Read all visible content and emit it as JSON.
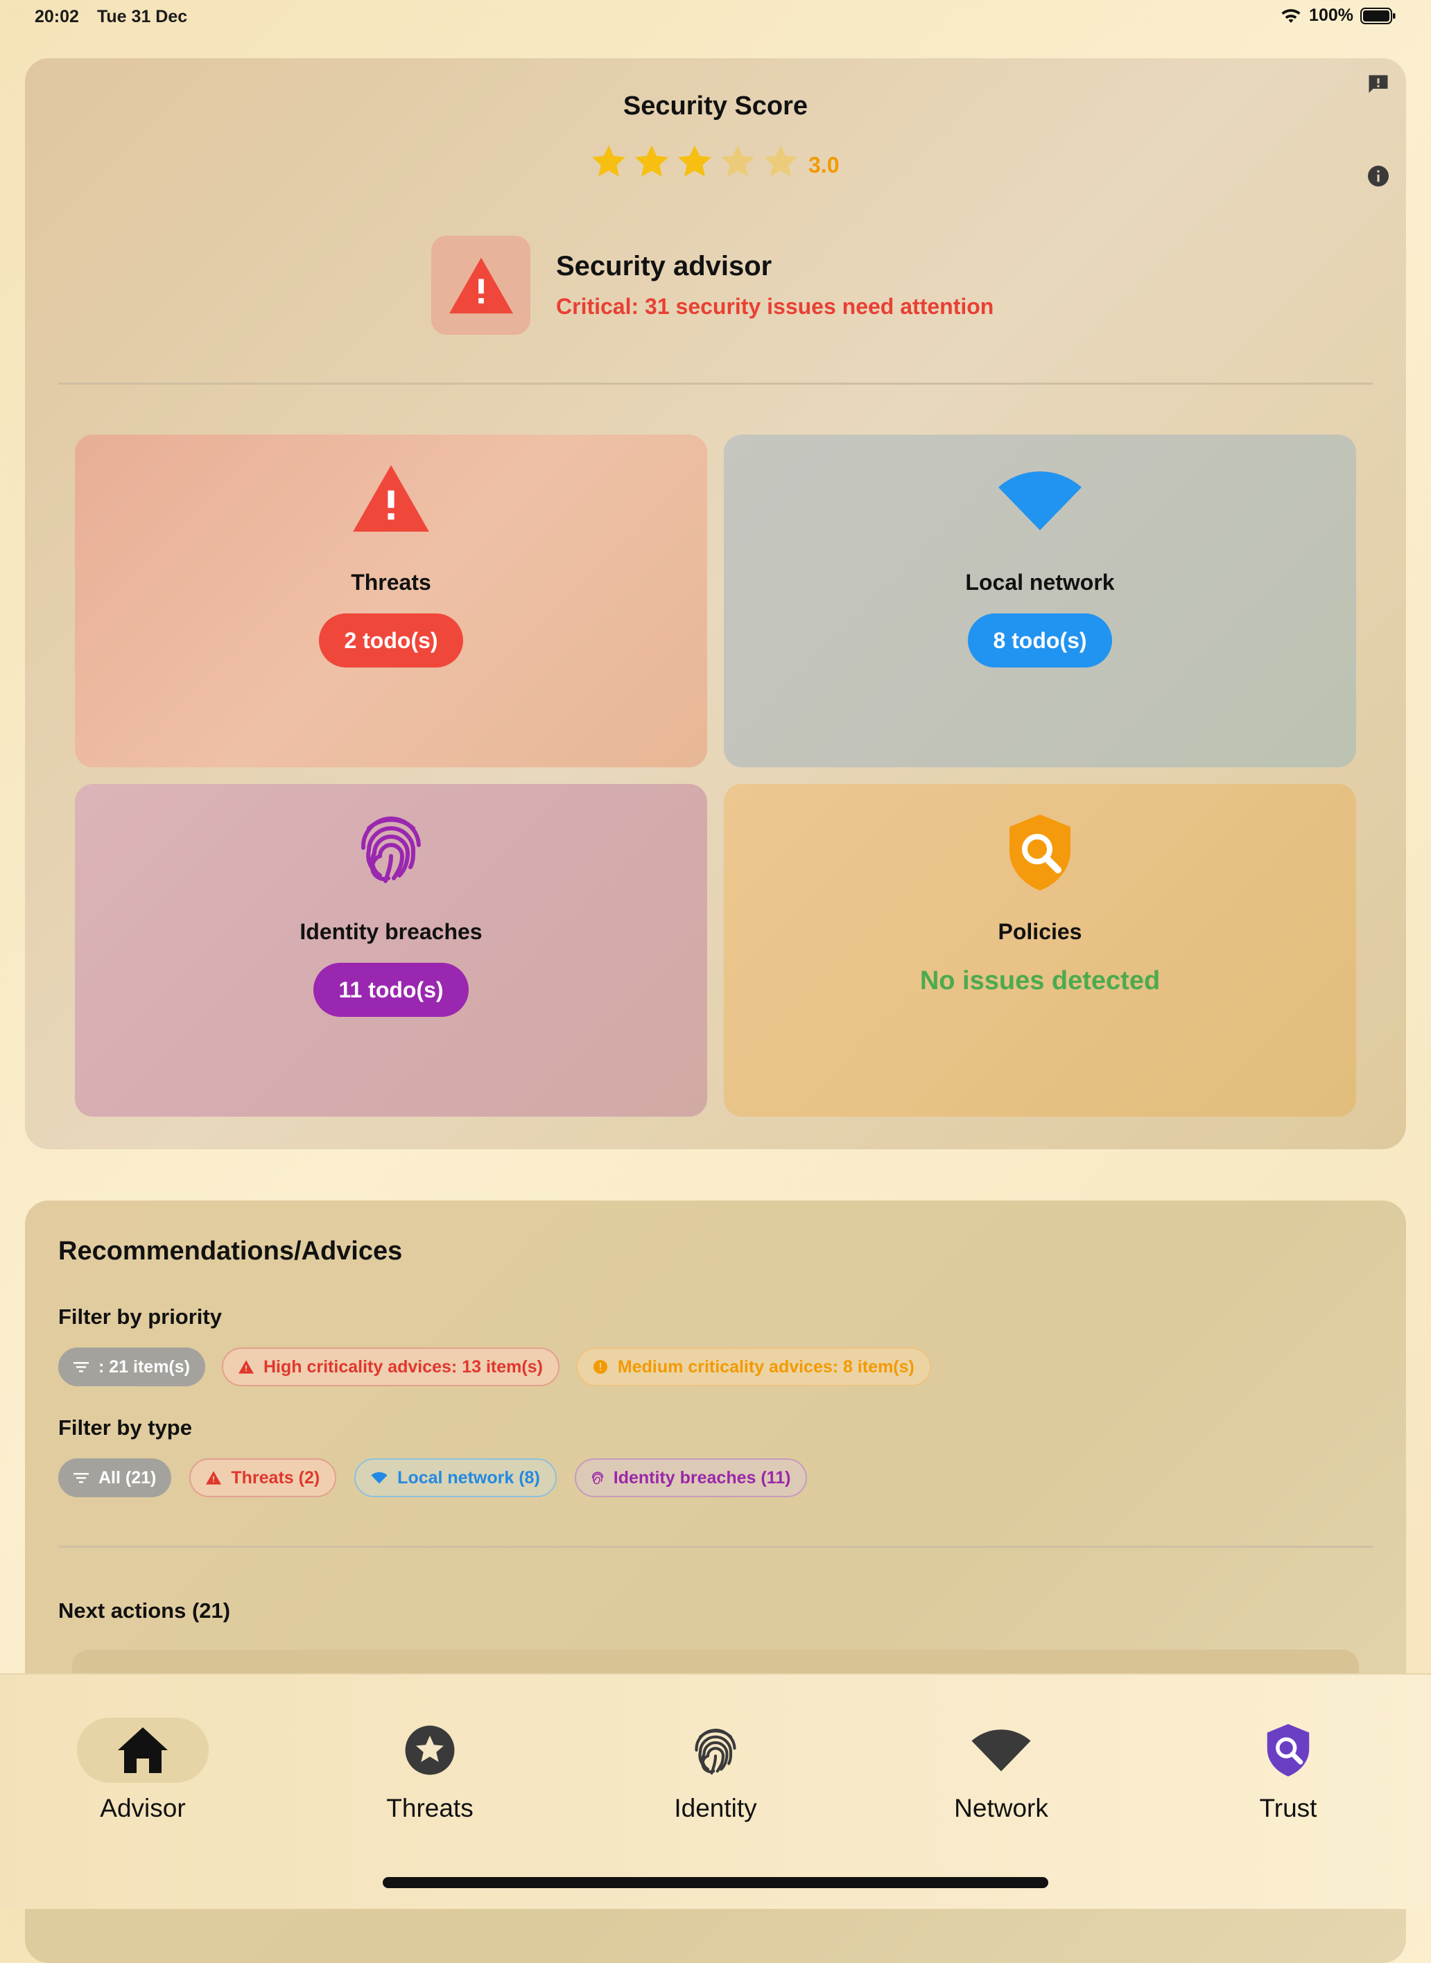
{
  "status_bar": {
    "time": "20:02",
    "date": "Tue 31 Dec",
    "battery": "100%"
  },
  "score": {
    "title": "Security Score",
    "value_label": "3.0",
    "rating": 3.0,
    "max": 5,
    "star_color": "#f6bf12"
  },
  "advisor": {
    "title": "Security advisor",
    "subtitle": "Critical: 31 security issues need attention",
    "icon": "warning-triangle-icon"
  },
  "tiles": [
    {
      "title": "Threats",
      "badge": "2 todo(s)",
      "icon": "warning-triangle-icon",
      "color": "#f0473b"
    },
    {
      "title": "Local network",
      "badge": "8 todo(s)",
      "icon": "wifi-icon",
      "color": "#2193f0"
    },
    {
      "title": "Identity breaches",
      "badge": "11 todo(s)",
      "icon": "fingerprint-icon",
      "color": "#9a27b0"
    },
    {
      "title": "Policies",
      "status": "No issues detected",
      "icon": "shield-search-icon",
      "color": "#f59a0c"
    }
  ],
  "recommendations": {
    "title": "Recommendations/Advices",
    "priority_label": "Filter by priority",
    "priority_chips": [
      {
        "label": ": 21 item(s)",
        "icon": "filter-icon"
      },
      {
        "label": "High criticality advices: 13 item(s)",
        "icon": "warning-triangle-icon"
      },
      {
        "label": "Medium criticality advices: 8 item(s)",
        "icon": "info-circle-icon"
      }
    ],
    "type_label": "Filter by type",
    "type_chips": [
      {
        "label": "All (21)",
        "icon": "filter-icon"
      },
      {
        "label": "Threats (2)",
        "icon": "warning-triangle-icon"
      },
      {
        "label": "Local network (8)",
        "icon": "wifi-icon"
      },
      {
        "label": "Identity breaches (11)",
        "icon": "fingerprint-icon"
      }
    ],
    "next_actions": "Next actions (21)"
  },
  "bottom_nav": [
    {
      "label": "Advisor",
      "icon": "home-icon",
      "active": true
    },
    {
      "label": "Threats",
      "icon": "star-circle-icon",
      "active": false
    },
    {
      "label": "Identity",
      "icon": "fingerprint-icon",
      "active": false
    },
    {
      "label": "Network",
      "icon": "wifi-icon",
      "active": false
    },
    {
      "label": "Trust",
      "icon": "shield-search-icon",
      "active": false
    }
  ]
}
